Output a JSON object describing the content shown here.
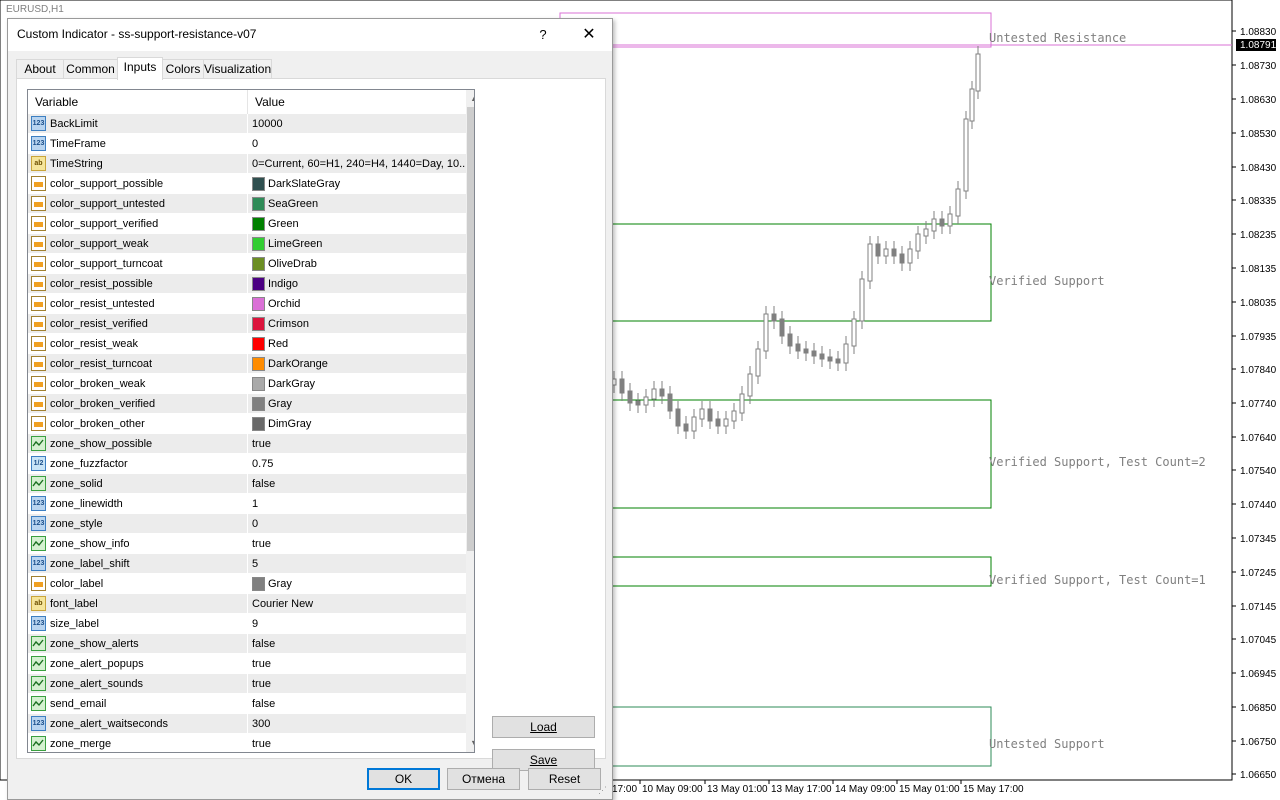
{
  "chart": {
    "symbol": "EURUSD,H1",
    "price_labels": [
      "1.08830",
      "1.08791",
      "1.08730",
      "1.08630",
      "1.08530",
      "1.08430",
      "1.08335",
      "1.08235",
      "1.08135",
      "1.08035",
      "1.07935",
      "1.07840",
      "1.07740",
      "1.07640",
      "1.07540",
      "1.07440",
      "1.07345",
      "1.07245",
      "1.07145",
      "1.07045",
      "1.06945",
      "1.06850",
      "1.06750",
      "1.06650"
    ],
    "current_price": "1.08791",
    "time_labels": [
      "17:00",
      "10 May 09:00",
      "13 May 01:00",
      "13 May 17:00",
      "14 May 09:00",
      "15 May 01:00",
      "15 May 17:00"
    ],
    "zones": [
      {
        "label": "Untested Resistance",
        "color": "#da70d6"
      },
      {
        "label": "Verified Support",
        "color": "#008000"
      },
      {
        "label": "Verified Support, Test Count=2",
        "color": "#008000"
      },
      {
        "label": "Verified Support, Test Count=1",
        "color": "#008000"
      },
      {
        "label": "Untested Support",
        "color": "#2e8b57"
      }
    ]
  },
  "dialog": {
    "title": "Custom Indicator - ss-support-resistance-v07",
    "help": "?",
    "close": "✕",
    "tabs": [
      "About",
      "Common",
      "Inputs",
      "Colors",
      "Visualization"
    ],
    "active_tab": "Inputs",
    "columns": {
      "variable": "Variable",
      "value": "Value"
    },
    "type_icons": {
      "int": "123",
      "double": "1/2",
      "string": "ab",
      "color": "",
      "bool": ""
    },
    "params": [
      {
        "type": "int",
        "name": "BackLimit",
        "value": "10000"
      },
      {
        "type": "int",
        "name": "TimeFrame",
        "value": "0"
      },
      {
        "type": "string",
        "name": "TimeString",
        "value": "0=Current, 60=H1, 240=H4, 1440=Day, 10..."
      },
      {
        "type": "color",
        "name": "color_support_possible",
        "value": "DarkSlateGray",
        "swatch": "#2f4f4f"
      },
      {
        "type": "color",
        "name": "color_support_untested",
        "value": "SeaGreen",
        "swatch": "#2e8b57"
      },
      {
        "type": "color",
        "name": "color_support_verified",
        "value": "Green",
        "swatch": "#008000"
      },
      {
        "type": "color",
        "name": "color_support_weak",
        "value": "LimeGreen",
        "swatch": "#32cd32"
      },
      {
        "type": "color",
        "name": "color_support_turncoat",
        "value": "OliveDrab",
        "swatch": "#6b8e23"
      },
      {
        "type": "color",
        "name": "color_resist_possible",
        "value": "Indigo",
        "swatch": "#4b0082"
      },
      {
        "type": "color",
        "name": "color_resist_untested",
        "value": "Orchid",
        "swatch": "#da70d6"
      },
      {
        "type": "color",
        "name": "color_resist_verified",
        "value": "Crimson",
        "swatch": "#dc143c"
      },
      {
        "type": "color",
        "name": "color_resist_weak",
        "value": "Red",
        "swatch": "#ff0000"
      },
      {
        "type": "color",
        "name": "color_resist_turncoat",
        "value": "DarkOrange",
        "swatch": "#ff8c00"
      },
      {
        "type": "color",
        "name": "color_broken_weak",
        "value": "DarkGray",
        "swatch": "#a9a9a9"
      },
      {
        "type": "color",
        "name": "color_broken_verified",
        "value": "Gray",
        "swatch": "#808080"
      },
      {
        "type": "color",
        "name": "color_broken_other",
        "value": "DimGray",
        "swatch": "#696969"
      },
      {
        "type": "bool",
        "name": "zone_show_possible",
        "value": "true"
      },
      {
        "type": "double",
        "name": "zone_fuzzfactor",
        "value": "0.75"
      },
      {
        "type": "bool",
        "name": "zone_solid",
        "value": "false"
      },
      {
        "type": "int",
        "name": "zone_linewidth",
        "value": "1"
      },
      {
        "type": "int",
        "name": "zone_style",
        "value": "0"
      },
      {
        "type": "bool",
        "name": "zone_show_info",
        "value": "true"
      },
      {
        "type": "int",
        "name": "zone_label_shift",
        "value": "5"
      },
      {
        "type": "color",
        "name": "color_label",
        "value": "Gray",
        "swatch": "#808080"
      },
      {
        "type": "string",
        "name": "font_label",
        "value": "Courier New"
      },
      {
        "type": "int",
        "name": "size_label",
        "value": "9"
      },
      {
        "type": "bool",
        "name": "zone_show_alerts",
        "value": "false"
      },
      {
        "type": "bool",
        "name": "zone_alert_popups",
        "value": "true"
      },
      {
        "type": "bool",
        "name": "zone_alert_sounds",
        "value": "true"
      },
      {
        "type": "bool",
        "name": "send_email",
        "value": "false"
      },
      {
        "type": "int",
        "name": "zone_alert_waitseconds",
        "value": "300"
      },
      {
        "type": "bool",
        "name": "zone_merge",
        "value": "true"
      }
    ],
    "buttons": {
      "load": "Load",
      "save": "Save",
      "ok": "OK",
      "cancel": "Отмена",
      "reset": "Reset"
    }
  }
}
